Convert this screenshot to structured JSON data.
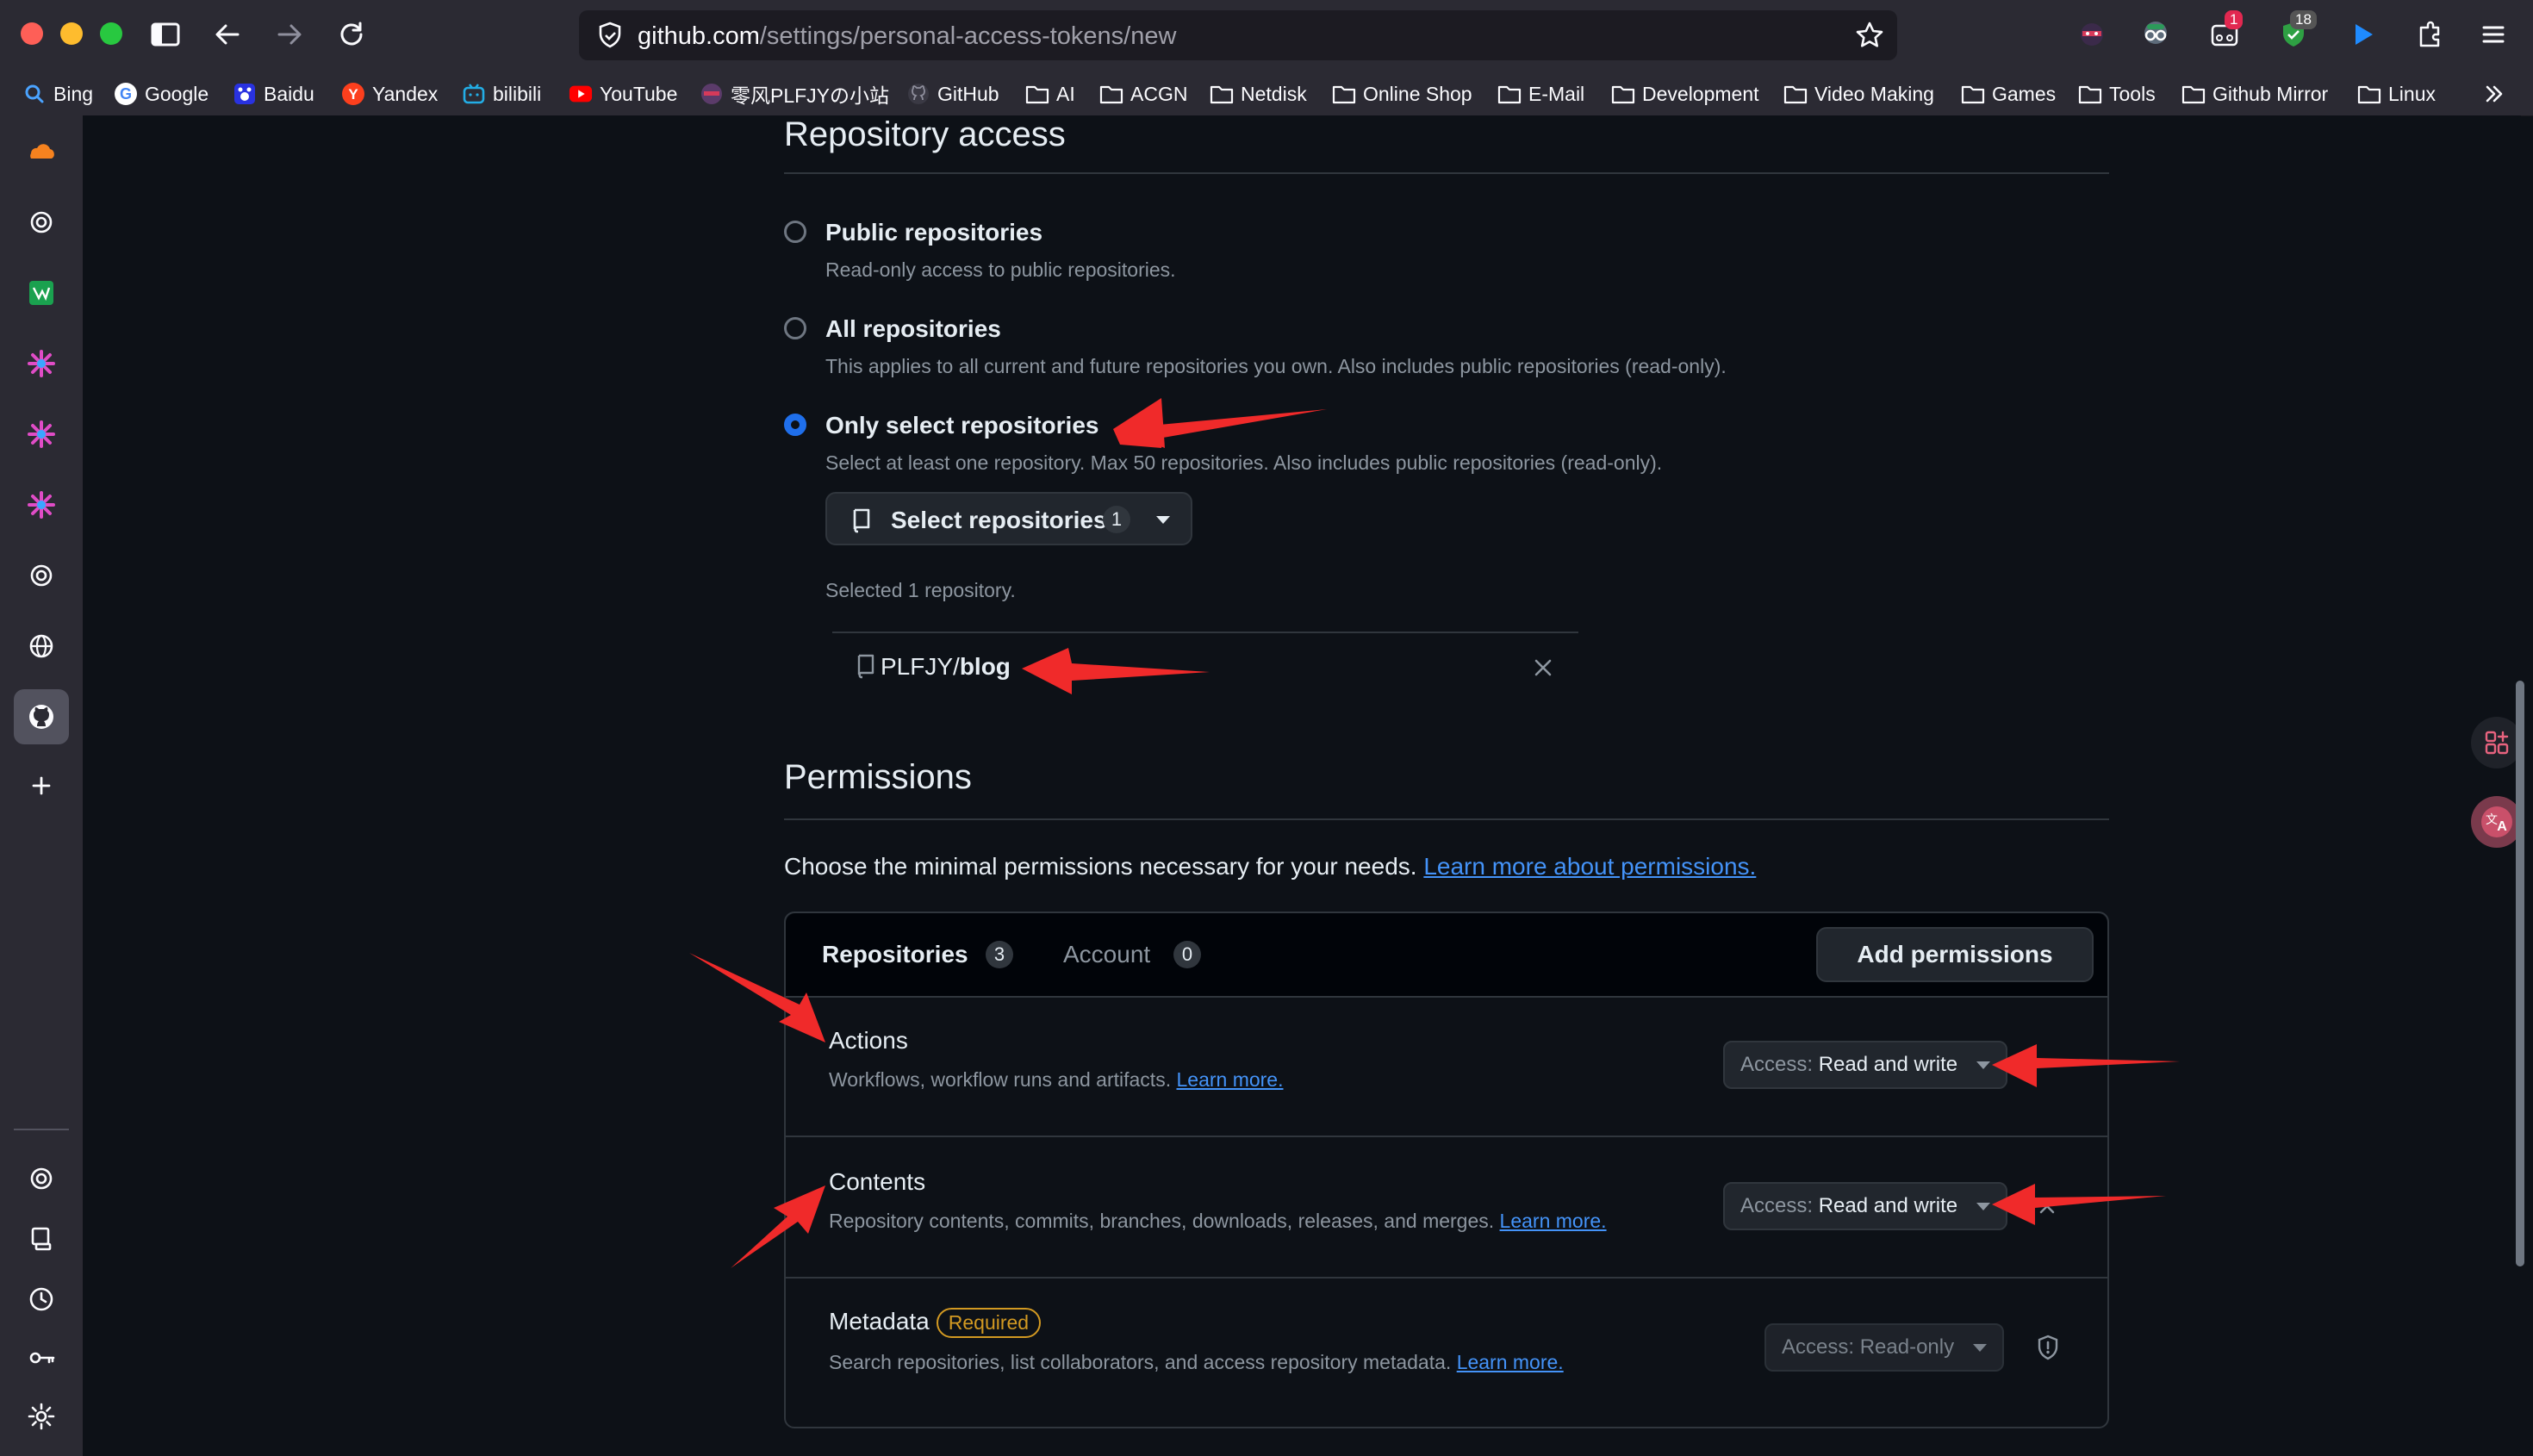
{
  "browser": {
    "url_host": "github.com",
    "url_path": "/settings/personal-access-tokens/new",
    "extensions": [
      {
        "name": "ninja-extension",
        "badge": ""
      },
      {
        "name": "glasses-extension",
        "badge": ""
      },
      {
        "name": "reader-extension",
        "badge": "1"
      },
      {
        "name": "shield-extension",
        "badge": "18"
      },
      {
        "name": "play-extension",
        "badge": ""
      }
    ]
  },
  "bookmarks": [
    {
      "label": "Bing",
      "icon": "search-icon"
    },
    {
      "label": "Google",
      "icon": "google-icon"
    },
    {
      "label": "Baidu",
      "icon": "baidu-icon"
    },
    {
      "label": "Yandex",
      "icon": "yandex-icon"
    },
    {
      "label": "bilibili",
      "icon": "bilibili-icon"
    },
    {
      "label": "YouTube",
      "icon": "youtube-icon"
    },
    {
      "label": "零风PLFJYの小站",
      "icon": "avatar-icon"
    },
    {
      "label": "GitHub",
      "icon": "github-icon"
    },
    {
      "label": "AI",
      "icon": "folder-icon"
    },
    {
      "label": "ACGN",
      "icon": "folder-icon"
    },
    {
      "label": "Netdisk",
      "icon": "folder-icon"
    },
    {
      "label": "Online Shop",
      "icon": "folder-icon"
    },
    {
      "label": "E-Mail",
      "icon": "folder-icon"
    },
    {
      "label": "Development",
      "icon": "folder-icon"
    },
    {
      "label": "Video Making",
      "icon": "folder-icon"
    },
    {
      "label": "Games",
      "icon": "folder-icon"
    },
    {
      "label": "Tools",
      "icon": "folder-icon"
    },
    {
      "label": "Github Mirror",
      "icon": "folder-icon"
    },
    {
      "label": "Linux",
      "icon": "folder-icon"
    }
  ],
  "repo_access": {
    "title": "Repository access",
    "options": [
      {
        "title": "Public repositories",
        "desc": "Read-only access to public repositories.",
        "checked": false
      },
      {
        "title": "All repositories",
        "desc": "This applies to all current and future repositories you own. Also includes public repositories (read-only).",
        "checked": false
      },
      {
        "title": "Only select repositories",
        "desc": "Select at least one repository. Max 50 repositories. Also includes public repositories (read-only).",
        "checked": true
      }
    ],
    "select_button_label": "Select repositories",
    "select_count": "1",
    "selected_text": "Selected 1 repository.",
    "selected_repo_owner": "PLFJY/",
    "selected_repo_name": "blog"
  },
  "permissions": {
    "title": "Permissions",
    "intro": "Choose the minimal permissions necessary for your needs.",
    "intro_link": "Learn more about permissions.",
    "tabs": [
      {
        "label": "Repositories",
        "count": "3"
      },
      {
        "label": "Account",
        "count": "0"
      }
    ],
    "add_button": "Add permissions",
    "rows": [
      {
        "title": "Actions",
        "desc": "Workflows, workflow runs and artifacts.",
        "link": "Learn more.",
        "access_prefix": "Access: ",
        "access_value": "Read and write"
      },
      {
        "title": "Contents",
        "desc": "Repository contents, commits, branches, downloads, releases, and merges.",
        "link": "Learn more.",
        "access_prefix": "Access: ",
        "access_value": "Read and write"
      },
      {
        "title": "Metadata",
        "badge": "Required",
        "desc": "Search repositories, list collaborators, and access repository metadata.",
        "link": "Learn more.",
        "access_prefix": "Access: ",
        "access_value": "Read-only"
      }
    ]
  },
  "colors": {
    "accent_blue": "#1f6feb",
    "link_blue": "#4493f8",
    "annotation_red": "#f02a2a",
    "required_amber": "#d29922"
  }
}
